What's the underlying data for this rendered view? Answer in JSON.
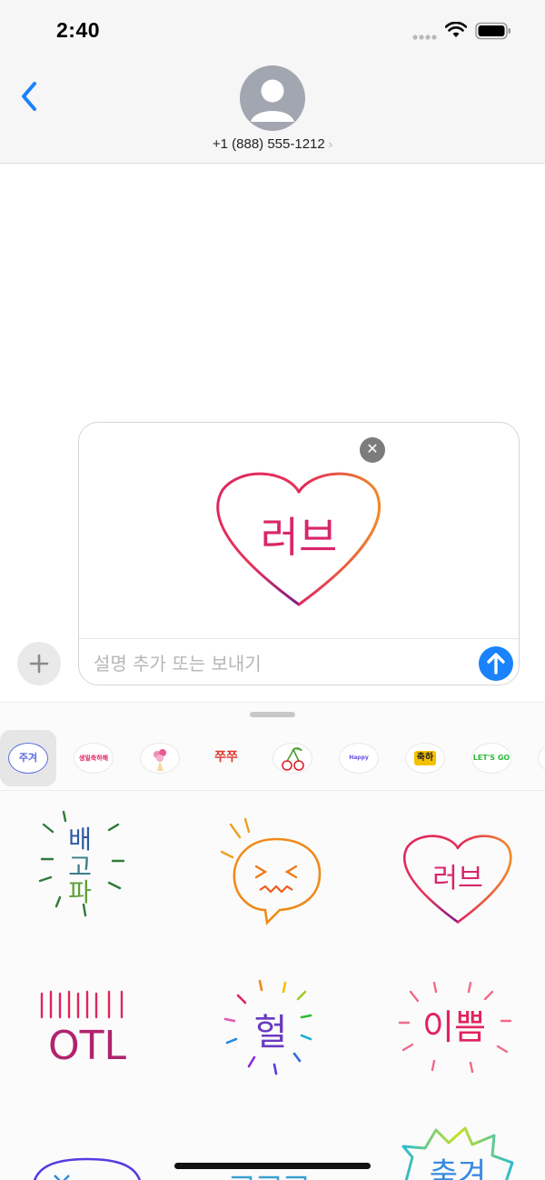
{
  "status_bar": {
    "time": "2:40",
    "signal_icon": "cellular-signal-icon",
    "wifi_icon": "wifi-icon",
    "battery_icon": "battery-full-icon"
  },
  "header": {
    "back_icon": "chevron-left-icon",
    "avatar_icon": "person-silhouette-icon",
    "contact_number": "+1 (888) 555-1212",
    "contact_chevron": "›"
  },
  "compose": {
    "preview_sticker_text": "러브",
    "remove_label": "✕",
    "input_placeholder": "설명 추가 또는 보내기",
    "input_value": "",
    "send_icon": "arrow-up-icon",
    "plus_icon": "plus-icon"
  },
  "sticker_packs": [
    {
      "icon": "pack-speech-bubble",
      "label": "주겨",
      "selected": true
    },
    {
      "icon": "pack-rainbow-text",
      "label": "생일축하해"
    },
    {
      "icon": "pack-flower-bouquet",
      "label": ""
    },
    {
      "icon": "pack-red-text",
      "label": "쭈쭈"
    },
    {
      "icon": "pack-cherry",
      "label": ""
    },
    {
      "icon": "pack-happy-birthday",
      "label": "Happy Birthday"
    },
    {
      "icon": "pack-red-burst",
      "label": "축하"
    },
    {
      "icon": "pack-lets-go",
      "label": "LET'S GO"
    }
  ],
  "stickers": [
    {
      "name": "sticker-hungry",
      "text": "배고파"
    },
    {
      "name": "sticker-angry-face-bubble",
      "text": ""
    },
    {
      "name": "sticker-love-heart",
      "text": "러브"
    },
    {
      "name": "sticker-otl",
      "text": "OTL"
    },
    {
      "name": "sticker-heol",
      "text": "헐"
    },
    {
      "name": "sticker-pretty",
      "text": "이쁨"
    },
    {
      "name": "sticker-yes-bubble",
      "text": ""
    },
    {
      "name": "sticker-kkk",
      "text": ""
    },
    {
      "name": "sticker-congrats-burst",
      "text": "축겨"
    }
  ],
  "colors": {
    "accent_blue": "#1a82fb",
    "header_bg": "#f6f6f6",
    "heart_pink": "#e0245e",
    "heart_orange": "#f08a2a",
    "heart_purple": "#7a1a8a"
  }
}
